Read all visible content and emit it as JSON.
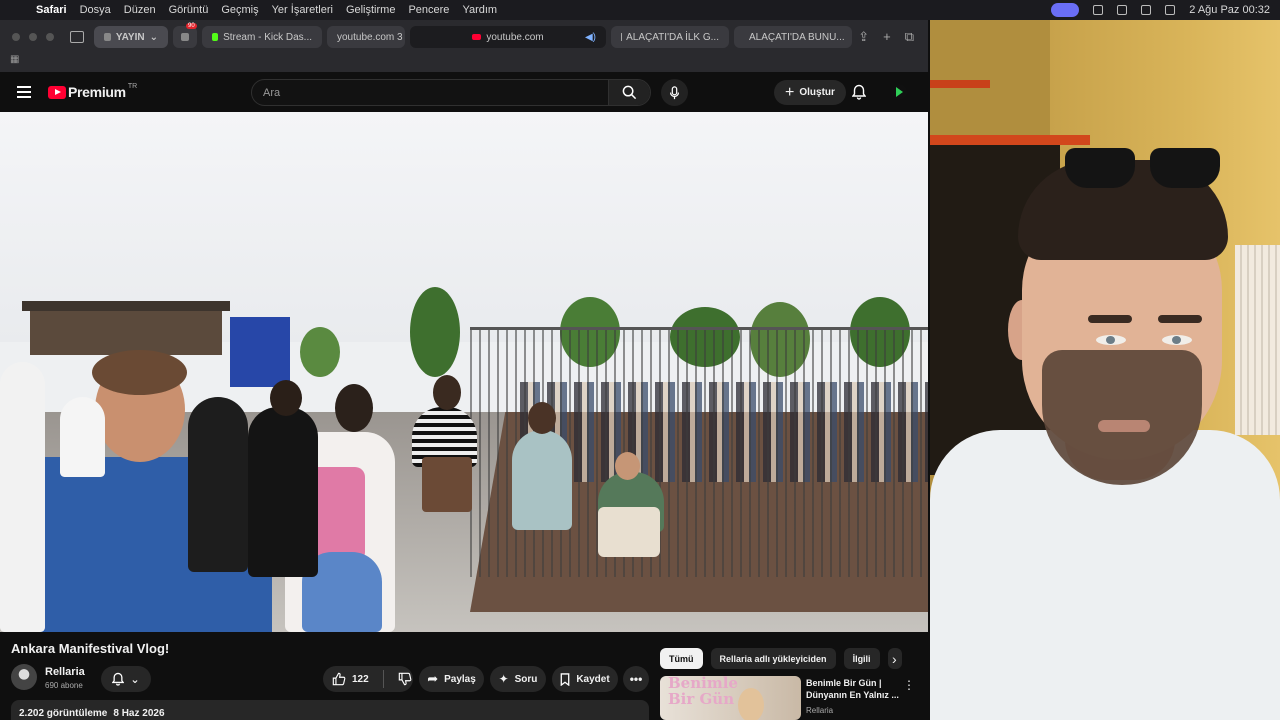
{
  "menubar": {
    "app": "Safari",
    "items": [
      "Dosya",
      "Düzen",
      "Görüntü",
      "Geçmiş",
      "Yer İşaretleri",
      "Geliştirme",
      "Pencere",
      "Yardım"
    ],
    "datetime": "2 Ağu Paz  00:32"
  },
  "safari": {
    "sidebar_pill": "YAYIN",
    "badge": "90",
    "tabs": [
      {
        "label": "Stream - Kick Das..."
      },
      {
        "label": "youtube.com 3"
      },
      {
        "label": "youtube.com"
      },
      {
        "label": "ALAÇATI'DA İLK G..."
      },
      {
        "label": "ALAÇATI'DA BUNU..."
      }
    ]
  },
  "yt": {
    "logo": "Premium",
    "region": "TR",
    "search_placeholder": "Ara",
    "create_label": "Oluştur"
  },
  "video": {
    "title": "Ankara Manifestival Vlog!",
    "channel": "Rellaria",
    "subscribers": "690 abone",
    "likes": "122",
    "share": "Paylaş",
    "ask": "Soru",
    "save": "Kaydet",
    "views": "2.202 görüntüleme",
    "date": "8 Haz 2026"
  },
  "related": {
    "chips": [
      "Tümü",
      "Rellaria adlı yükleyiciden",
      "İlgili"
    ],
    "item": {
      "thumb_text": "Benimle Bir Gün",
      "title": "Benimle Bir Gün | Dünyanın En Yalnız ...",
      "channel": "Rellaria"
    }
  }
}
